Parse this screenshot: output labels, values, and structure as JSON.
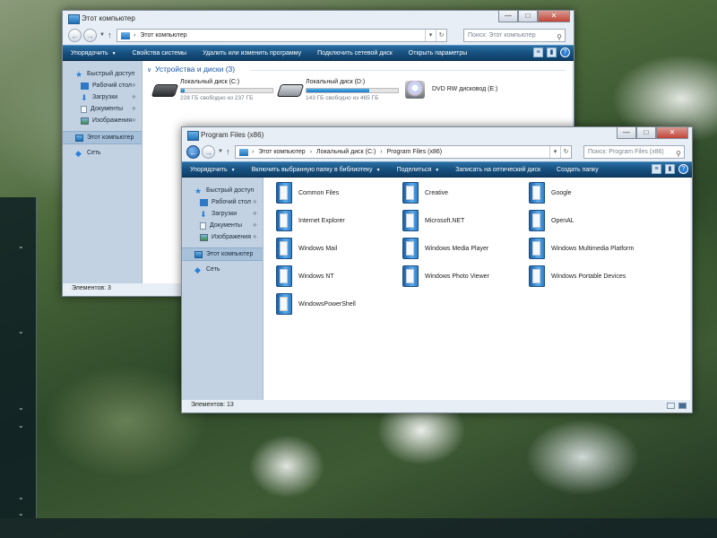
{
  "taskbar": {
    "chevron": "⌄"
  },
  "win_computer": {
    "title": "Этот компьютер",
    "address": {
      "location": "Этот компьютер"
    },
    "search": {
      "placeholder": "Поиск: Этот компьютер"
    },
    "toolbar": [
      "Упорядочить",
      "Свойства системы",
      "Удалить или изменить программу",
      "Подключить сетевой диск",
      "Открыть параметры"
    ],
    "nav": [
      {
        "label": "Быстрый доступ",
        "icon": "star-icon"
      },
      {
        "label": "Рабочий стол",
        "icon": "desktop-icon",
        "pinned": true
      },
      {
        "label": "Загрузки",
        "icon": "downloads-icon",
        "pinned": true
      },
      {
        "label": "Документы",
        "icon": "documents-icon",
        "pinned": true
      },
      {
        "label": "Изображения",
        "icon": "pictures-icon",
        "pinned": true
      },
      {
        "label": "Этот компьютер",
        "icon": "computer-icon",
        "selected": true
      },
      {
        "label": "Сеть",
        "icon": "network-icon"
      }
    ],
    "group_title": "Устройства и диски (3)",
    "drives": [
      {
        "name": "Локальный диск (C:)",
        "free": "228 ГБ свободно из 237 ГБ",
        "used_fraction": 0.04,
        "icon": "hard-drive-icon"
      },
      {
        "name": "Локальный диск (D:)",
        "free": "143 ГБ свободно из 465 ГБ",
        "used_fraction": 0.69,
        "icon": "hard-drive-icon"
      },
      {
        "name": "DVD RW дисковод (E:)",
        "icon": "dvd-drive-icon"
      }
    ],
    "status": "Элементов: 3"
  },
  "win_programs": {
    "title": "Program Files (x86)",
    "address": {
      "crumbs": [
        "Этот компьютер",
        "Локальный диск (C:)",
        "Program Files (x86)"
      ]
    },
    "search": {
      "placeholder": "Поиск: Program Files (x86)"
    },
    "toolbar": [
      "Упорядочить",
      "Включить выбранную папку в библиотеку",
      "Поделиться",
      "Записать на оптический диск",
      "Создать папку"
    ],
    "nav": [
      {
        "label": "Быстрый доступ",
        "icon": "star-icon"
      },
      {
        "label": "Рабочий стол",
        "icon": "desktop-icon",
        "pinned": true
      },
      {
        "label": "Загрузки",
        "icon": "downloads-icon",
        "pinned": true
      },
      {
        "label": "Документы",
        "icon": "documents-icon",
        "pinned": true
      },
      {
        "label": "Изображения",
        "icon": "pictures-icon",
        "pinned": true
      },
      {
        "label": "Этот компьютер",
        "icon": "computer-icon",
        "selected": true
      },
      {
        "label": "Сеть",
        "icon": "network-icon"
      }
    ],
    "folders": [
      "Common Files",
      "Creative",
      "Google",
      "Internet Explorer",
      "Microsoft.NET",
      "OpenAL",
      "Windows Mail",
      "Windows Media Player",
      "Windows Multimedia Platform",
      "Windows NT",
      "Windows Photo Viewer",
      "Windows Portable Devices",
      "WindowsPowerShell"
    ],
    "status": "Элементов: 13"
  },
  "colors": {
    "toolbar": "#16507e",
    "sidebar": "#c2d2e3",
    "group_title": "#1a57a4",
    "drive_fill": "#1b78c4"
  }
}
